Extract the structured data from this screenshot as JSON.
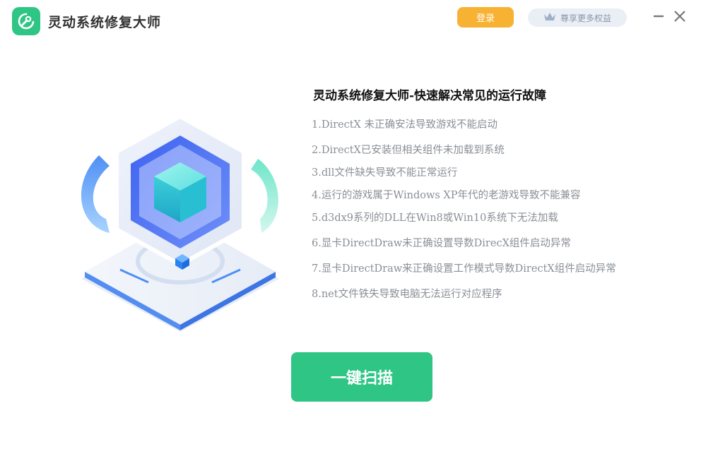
{
  "app": {
    "title": "灵动系统修复大师"
  },
  "header": {
    "login_label": "登录",
    "vip_label": "尊享更多权益"
  },
  "info": {
    "title": "灵动系统修复大师-快速解决常见的运行故障",
    "issues": [
      "1.DirectX        未正确安法导致游戏不能启动",
      "2.DirectX已安装但相关组件未加载到系统",
      "3.dll文件缺失导致不能正常运行",
      "4.运行的游戏属于Windows XP年代的老游戏导致不能兼容",
      "5.d3dx9系列的DLL在Win8或Win10系统下无法加载",
      "6.显卡DirectDraw未正确设置导数DirecX组件启动异常",
      "7.显卡DirectDraw来正确设置工作模式导数DirectX组件启动异常",
      "8.net文件铁失导致电脑无法运行对应程序"
    ]
  },
  "actions": {
    "scan_label": "一键扫描"
  },
  "colors": {
    "brand_green": "#2ec585",
    "login_orange": "#f8b233",
    "vip_bg": "#eaeff6"
  },
  "icons": {
    "app_logo": "wrench-refresh-icon",
    "vip": "crown-icon",
    "minimize": "minimize-icon",
    "close": "close-icon"
  }
}
